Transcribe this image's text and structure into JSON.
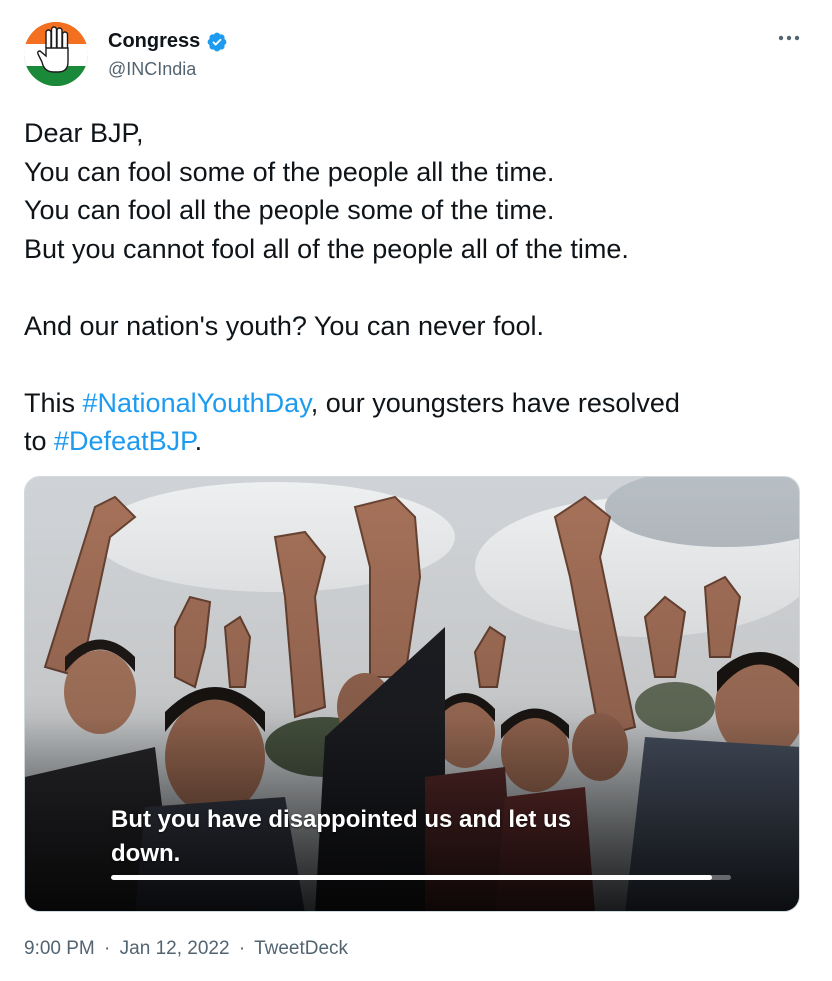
{
  "author": {
    "display_name": "Congress",
    "handle": "@INCIndia",
    "verified": true,
    "avatar_icon": "congress-hand-logo-icon",
    "verified_icon": "verified-badge-icon",
    "more_icon": "more-options-icon"
  },
  "tweet": {
    "lines": [
      "Dear BJP,",
      "You can fool some of the people all the time.",
      "You can fool all the people some of the time.",
      "But you cannot fool all of the people all of the time."
    ],
    "paragraph2": "And our nation's youth? You can never fool.",
    "p3_prefix": "This ",
    "hashtag1": "#NationalYouthDay",
    "p3_middle": ", our youngsters have resolved",
    "p3_line2_prefix": "to ",
    "hashtag2": "#DefeatBJP",
    "p3_end": "."
  },
  "media": {
    "caption_line1": "But you have disappointed us and let us",
    "caption_line2": "down.",
    "progress": 0.97
  },
  "meta": {
    "time": "9:00 PM",
    "separator": "·",
    "date": "Jan 12, 2022",
    "source": "TweetDeck"
  },
  "colors": {
    "link": "#1d9bf0",
    "secondary_text": "#536471",
    "verified": "#1d9bf0"
  }
}
